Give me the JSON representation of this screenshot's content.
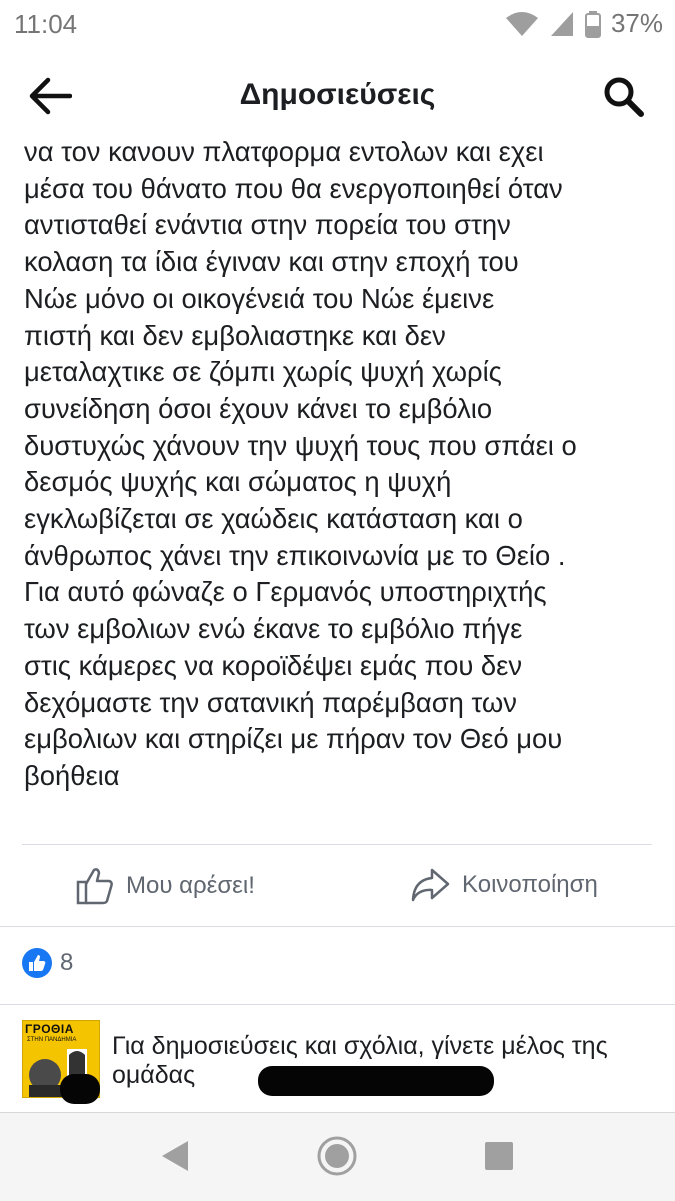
{
  "status_bar": {
    "time": "11:04",
    "battery_percent": "37%",
    "icons": [
      "wifi-icon",
      "signal-icon",
      "battery-icon"
    ]
  },
  "app_bar": {
    "title": "Δημοσιεύσεις",
    "back_icon": "arrow-left-icon",
    "search_icon": "search-icon"
  },
  "post": {
    "lines": [
      "να τον κανουν πλατφορμα εντολων και εχει",
      "μέσα του θάνατο που θα ενεργοποιηθεί όταν",
      "αντισταθεί ενάντια στην πορεία του στην",
      "κολαση τα ίδια έγιναν και στην εποχή του",
      "Νώε μόνο οι οικογένειά του Νώε έμεινε",
      "πιστή και δεν εμβολιαστηκε και δεν",
      "μεταλαχτικε σε ζόμπι χωρίς ψυχή χωρίς",
      "συνείδηση όσοι έχουν κάνει το εμβόλιο",
      "δυστυχώς χάνουν την ψυχή τους που σπάει ο",
      "δεσμός ψυχής και σώματος η ψυχή",
      "εγκλωβίζεται σε χαώδεις κατάσταση και ο",
      "άνθρωπος χάνει την επικοινωνία με το Θείο .",
      "Για αυτό φώναζε ο Γερμανός υποστηριχτής",
      "των εμβολιων ενώ έκανε το εμβόλιο πήγε",
      "στις κάμερες να κοροϊδέψει εμάς που δεν",
      "δεχόμαστε την σατανική παρέμβαση των",
      "εμβολιων και στηρίζει με πήραν τον Θεό μου",
      "βοήθεια"
    ]
  },
  "actions": {
    "like_label": "Μου αρέσει!",
    "share_label": "Κοινοποίηση"
  },
  "reactions": {
    "count": "8"
  },
  "group_notice": {
    "avatar_label": "ΓΡΟΘΙΑ",
    "avatar_sublabel": "ΣΤΗΝ ΠΑΝΔΗΜΙΑ",
    "text": "Για δημοσιεύσεις και σχόλια, γίνετε μέλος της ομάδας"
  },
  "colors": {
    "accent": "#1877f2",
    "text": "#1c1e21",
    "secondary_text": "#606770",
    "avatar_bg": "#f5c400"
  }
}
